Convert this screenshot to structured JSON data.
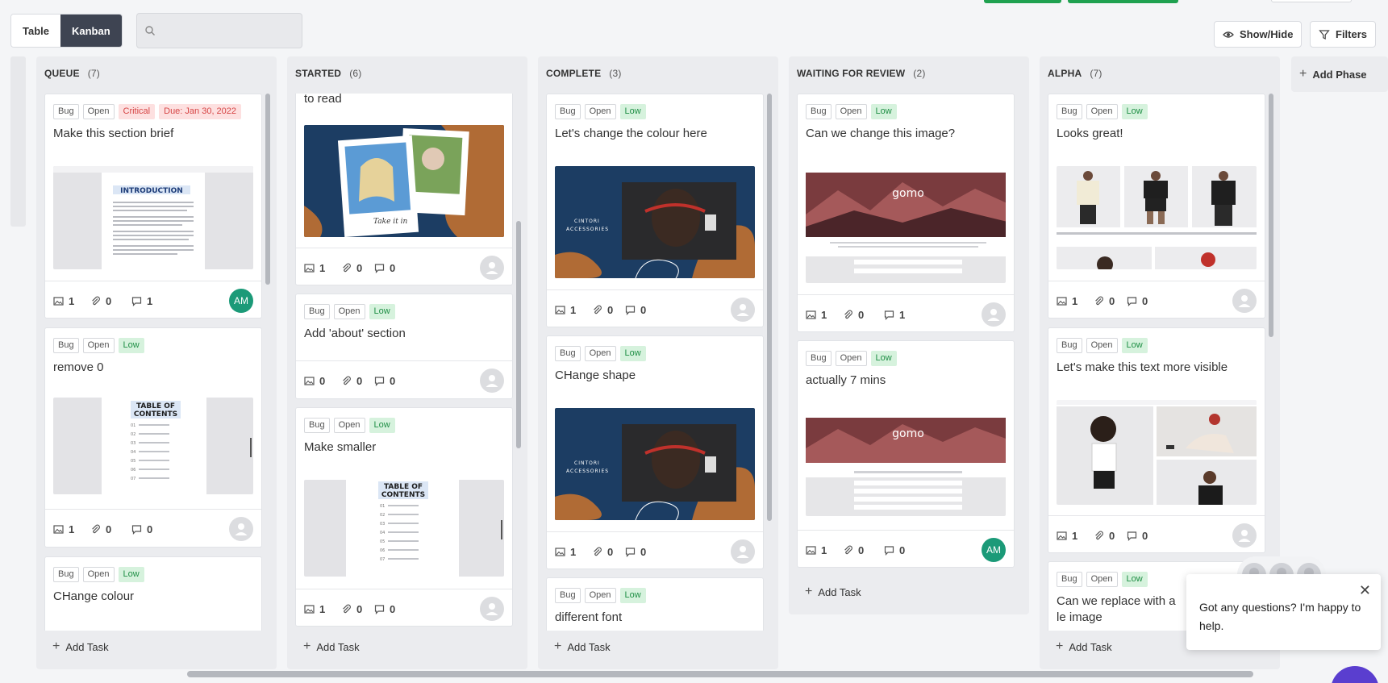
{
  "toolbar": {
    "views": [
      {
        "label": "Table",
        "active": false
      },
      {
        "label": "Kanban",
        "active": true
      }
    ],
    "search": {
      "placeholder": ""
    },
    "show_hide_label": "Show/Hide",
    "filters_label": "Filters",
    "accent_green": "#1fa150"
  },
  "columns": [
    {
      "title": "QUEUE",
      "count": "(7)",
      "cards": [
        {
          "tags": [
            "Bug",
            "Open",
            "Critical",
            "Due: Jan 30, 2022"
          ],
          "title": "Make this section brief",
          "thumb": "introduction-doc",
          "images": "1",
          "attachments": "0",
          "comments": "1",
          "assignee": "AM"
        },
        {
          "tags": [
            "Bug",
            "Open",
            "Low"
          ],
          "title": "remove 0",
          "thumb": "table-of-contents",
          "images": "1",
          "attachments": "0",
          "comments": "0",
          "assignee": ""
        },
        {
          "tags": [
            "Bug",
            "Open",
            "Low"
          ],
          "title": "CHange colour",
          "thumb": "",
          "images": "",
          "attachments": "",
          "comments": "",
          "assignee": ""
        }
      ],
      "add_task": "Add Task"
    },
    {
      "title": "STARTED",
      "count": "(6)",
      "cards": [
        {
          "tags": [],
          "title": "to read",
          "thumb": "polaroid-people",
          "images": "1",
          "attachments": "0",
          "comments": "0",
          "assignee": ""
        },
        {
          "tags": [
            "Bug",
            "Open",
            "Low"
          ],
          "title": "Add 'about' section",
          "thumb": "",
          "images": "0",
          "attachments": "0",
          "comments": "0",
          "assignee": ""
        },
        {
          "tags": [
            "Bug",
            "Open",
            "Low"
          ],
          "title": "Make smaller",
          "thumb": "table-of-contents",
          "images": "1",
          "attachments": "0",
          "comments": "0",
          "assignee": ""
        }
      ],
      "add_task": "Add Task"
    },
    {
      "title": "COMPLETE",
      "count": "(3)",
      "cards": [
        {
          "tags": [
            "Bug",
            "Open",
            "Low"
          ],
          "title": "Let's change the colour here",
          "thumb": "accessories-banner",
          "images": "1",
          "attachments": "0",
          "comments": "0",
          "assignee": ""
        },
        {
          "tags": [
            "Bug",
            "Open",
            "Low"
          ],
          "title": "CHange shape",
          "thumb": "accessories-banner",
          "images": "1",
          "attachments": "0",
          "comments": "0",
          "assignee": ""
        },
        {
          "tags": [
            "Bug",
            "Open",
            "Low"
          ],
          "title": "different font",
          "thumb": "",
          "images": "",
          "attachments": "",
          "comments": "",
          "assignee": ""
        }
      ],
      "add_task": "Add Task"
    },
    {
      "title": "WAITING FOR REVIEW",
      "count": "(2)",
      "cards": [
        {
          "tags": [
            "Bug",
            "Open",
            "Low"
          ],
          "title": "Can we change this image?",
          "thumb": "mountain-site",
          "images": "1",
          "attachments": "0",
          "comments": "1",
          "assignee": ""
        },
        {
          "tags": [
            "Bug",
            "Open",
            "Low"
          ],
          "title": "actually 7 mins",
          "thumb": "mountain-site",
          "images": "1",
          "attachments": "0",
          "comments": "0",
          "assignee": "AM"
        }
      ],
      "add_task": "Add Task"
    },
    {
      "title": "ALPHA",
      "count": "(7)",
      "cards": [
        {
          "tags": [
            "Bug",
            "Open",
            "Low"
          ],
          "title": "Looks great!",
          "thumb": "apparel-grid",
          "images": "1",
          "attachments": "0",
          "comments": "0",
          "assignee": ""
        },
        {
          "tags": [
            "Bug",
            "Open",
            "Low"
          ],
          "title": "Let's make this text more visible",
          "thumb": "apparel-models",
          "images": "1",
          "attachments": "0",
          "comments": "0",
          "assignee": ""
        },
        {
          "tags": [
            "Bug",
            "Open",
            "Low"
          ],
          "title": "Can we replace with a le image",
          "thumb": "",
          "images": "",
          "attachments": "",
          "comments": "",
          "assignee": ""
        }
      ],
      "add_task": "Add Task"
    }
  ],
  "add_phase": "Add Phase",
  "chat": {
    "message": "Got any questions? I'm happy to help.",
    "close": "✕"
  },
  "colors": {
    "low_bg": "#d6f2dd",
    "low_fg": "#1f8f45",
    "critical_bg": "#fde0e0",
    "critical_fg": "#d64545",
    "avatar_am": "#1b9a78",
    "kanban_active": "#3e4452"
  }
}
